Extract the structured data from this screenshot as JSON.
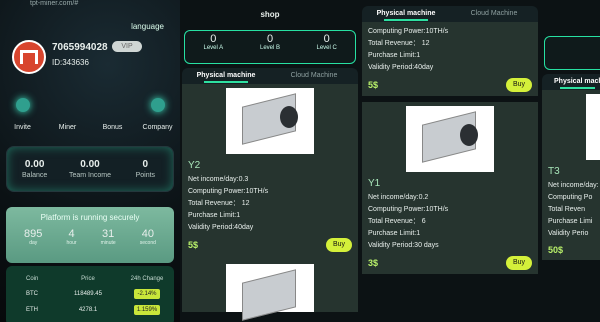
{
  "profile": {
    "url": "tpt-miner.com/#",
    "language": "language",
    "phone": "7065994028",
    "vip": "VIP",
    "id": "ID:343636",
    "menu": [
      {
        "label": "Invite",
        "icon": "plus-icon"
      },
      {
        "label": "Miner",
        "icon": "miner-icon"
      },
      {
        "label": "Bonus",
        "icon": "bonus-icon"
      },
      {
        "label": "Company",
        "icon": "company-icon"
      }
    ],
    "stats": [
      {
        "value": "0.00",
        "label": "Balance"
      },
      {
        "value": "0.00",
        "label": "Team Income"
      },
      {
        "value": "0",
        "label": "Points"
      }
    ],
    "secure_title": "Platform is running securely",
    "countdown": [
      {
        "value": "895",
        "label": "day"
      },
      {
        "value": "4",
        "label": "hour"
      },
      {
        "value": "31",
        "label": "minute"
      },
      {
        "value": "40",
        "label": "second"
      }
    ],
    "prices_header": {
      "coin": "Coin",
      "price": "Price",
      "change": "24h Change"
    },
    "prices": [
      {
        "coin": "BTC",
        "price": "118489.45",
        "change": "-2.14%"
      },
      {
        "coin": "ETH",
        "price": "4278.1",
        "change": "1.159%"
      }
    ]
  },
  "shop": {
    "title": "shop",
    "levels": [
      {
        "count": "0",
        "name": "Level A"
      },
      {
        "count": "0",
        "name": "Level B"
      },
      {
        "count": "0",
        "name": "Level C"
      }
    ],
    "tabs": [
      "Physical machine",
      "Cloud Machine"
    ],
    "buy_label": "Buy"
  },
  "products": {
    "y2": {
      "name": "Y2",
      "income": "Net income/day:0.3",
      "power": "Computing Power:10TH/s",
      "revenue": "Total Revenue： 12",
      "limit": "Purchase Limit:1",
      "validity": "Validity Period:40day",
      "price": "5$"
    },
    "prev": {
      "power": "Computing Power:10TH/s",
      "revenue": "Total Revenue： 12",
      "limit": "Purchase Limit:1",
      "validity": "Validity Period:40day",
      "price": "5$"
    },
    "y1": {
      "name": "Y1",
      "income": "Net income/day:0.2",
      "power": "Computing Power:10TH/s",
      "revenue": "Total Revenue： 6",
      "limit": "Purchase Limit:1",
      "validity": "Validity Period:30 days",
      "price": "3$"
    },
    "t3": {
      "name": "T3",
      "income": "Net income/day:",
      "power": "Computing Po",
      "revenue": "Total Reven",
      "limit": "Purchase Limi",
      "validity": "Validity Perio",
      "price": "50$",
      "tab": "Physical machi"
    }
  }
}
